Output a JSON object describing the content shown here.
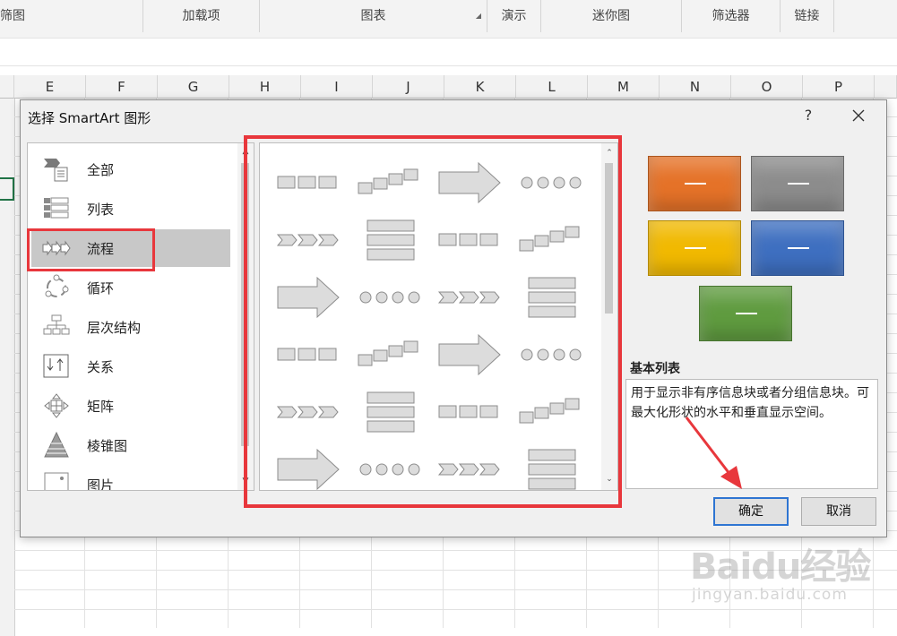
{
  "ribbon": {
    "groups": [
      {
        "label": "筛图"
      },
      {
        "label": "加载项"
      },
      {
        "label": "图表"
      },
      {
        "label": "演示"
      },
      {
        "label": "迷你图"
      },
      {
        "label": "筛选器"
      },
      {
        "label": "链接"
      }
    ]
  },
  "sheet": {
    "columns": [
      "E",
      "F",
      "G",
      "H",
      "I",
      "J",
      "K",
      "L",
      "M",
      "N",
      "O",
      "P"
    ]
  },
  "dialog": {
    "title": "选择 SmartArt 图形",
    "help": "?",
    "categories": [
      {
        "label": "全部",
        "icon": "all-icon"
      },
      {
        "label": "列表",
        "icon": "list-icon"
      },
      {
        "label": "流程",
        "icon": "process-icon",
        "selected": true
      },
      {
        "label": "循环",
        "icon": "cycle-icon"
      },
      {
        "label": "层次结构",
        "icon": "hierarchy-icon"
      },
      {
        "label": "关系",
        "icon": "relationship-icon"
      },
      {
        "label": "矩阵",
        "icon": "matrix-icon"
      },
      {
        "label": "棱锥图",
        "icon": "pyramid-icon"
      },
      {
        "label": "图片",
        "icon": "picture-icon"
      }
    ],
    "layouts": [
      "basic-process",
      "step-up-process",
      "step-down-process",
      "accent-process",
      "alternating-flow",
      "continuous-block-process",
      "increasing-arrows-process",
      "timeline",
      "basic-chevron-process",
      "closed-chevron-process",
      "upward-arrow",
      "circle-arrow-process",
      "basic-bending-process",
      "repeating-bending-process",
      "detailed-process",
      "subprocess",
      "vertical-chevron-list",
      "vertical-process",
      "phased-process",
      "circle-accent-timeline",
      "picture-accent-process",
      "equation",
      "funnel",
      "gear"
    ],
    "preview": {
      "name": "基本列表",
      "description": "用于显示非有序信息块或者分组信息块。可最大化形状的水平和垂直显示空间。",
      "colors": [
        "#e57228",
        "#8c8c8c",
        "#f1b900",
        "#3e6fc0",
        "#5f9b3f"
      ]
    },
    "ok_label": "确定",
    "cancel_label": "取消"
  },
  "watermark": {
    "logo": "Baidu经验",
    "url": "jingyan.baidu.com"
  }
}
